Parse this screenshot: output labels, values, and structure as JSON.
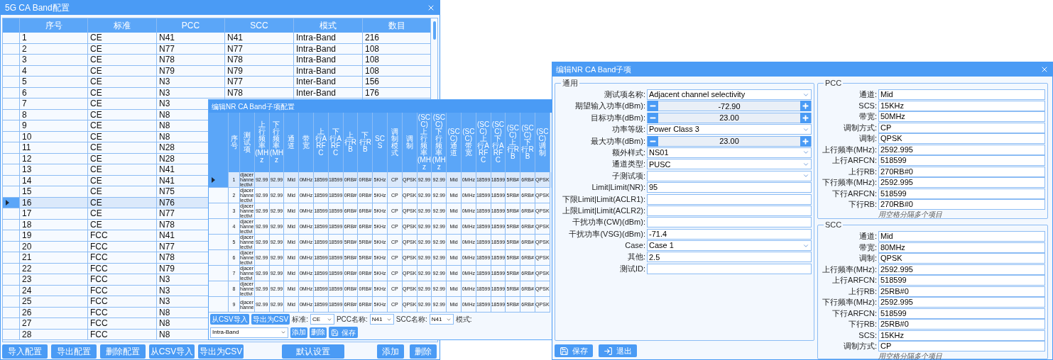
{
  "main_window": {
    "title": "5G CA Band配置",
    "table": {
      "columns": [
        "序号",
        "标准",
        "PCC",
        "SCC",
        "模式",
        "数目"
      ],
      "rows": [
        {
          "cells": [
            "1",
            "CE",
            "N41",
            "N41",
            "Intra-Band",
            "216"
          ],
          "selected": false
        },
        {
          "cells": [
            "2",
            "CE",
            "N77",
            "N77",
            "Intra-Band",
            "108"
          ],
          "selected": false
        },
        {
          "cells": [
            "3",
            "CE",
            "N78",
            "N78",
            "Intra-Band",
            "108"
          ],
          "selected": false
        },
        {
          "cells": [
            "4",
            "CE",
            "N79",
            "N79",
            "Intra-Band",
            "108"
          ],
          "selected": false
        },
        {
          "cells": [
            "5",
            "CE",
            "N3",
            "N77",
            "Inter-Band",
            "156"
          ],
          "selected": false
        },
        {
          "cells": [
            "6",
            "CE",
            "N3",
            "N78",
            "Inter-Band",
            "176"
          ],
          "selected": false
        },
        {
          "cells": [
            "7",
            "CE",
            "N3"
          ],
          "selected": false
        },
        {
          "cells": [
            "8",
            "CE",
            "N8"
          ],
          "selected": false
        },
        {
          "cells": [
            "9",
            "CE",
            "N8"
          ],
          "selected": false
        },
        {
          "cells": [
            "10",
            "CE",
            "N8"
          ],
          "selected": false
        },
        {
          "cells": [
            "11",
            "CE",
            "N28"
          ],
          "selected": false
        },
        {
          "cells": [
            "12",
            "CE",
            "N28"
          ],
          "selected": false
        },
        {
          "cells": [
            "13",
            "CE",
            "N41"
          ],
          "selected": false
        },
        {
          "cells": [
            "14",
            "CE",
            "N41"
          ],
          "selected": false
        },
        {
          "cells": [
            "15",
            "CE",
            "N75"
          ],
          "selected": false
        },
        {
          "cells": [
            "16",
            "CE",
            "N76"
          ],
          "selected": true
        },
        {
          "cells": [
            "17",
            "CE",
            "N77"
          ],
          "selected": false
        },
        {
          "cells": [
            "18",
            "CE",
            "N78"
          ],
          "selected": false
        },
        {
          "cells": [
            "19",
            "FCC",
            "N41"
          ],
          "selected": false
        },
        {
          "cells": [
            "20",
            "FCC",
            "N77"
          ],
          "selected": false
        },
        {
          "cells": [
            "21",
            "FCC",
            "N78"
          ],
          "selected": false
        },
        {
          "cells": [
            "22",
            "FCC",
            "N79"
          ],
          "selected": false
        },
        {
          "cells": [
            "23",
            "FCC",
            "N3"
          ],
          "selected": false
        },
        {
          "cells": [
            "24",
            "FCC",
            "N3"
          ],
          "selected": false
        },
        {
          "cells": [
            "25",
            "FCC",
            "N3"
          ],
          "selected": false
        },
        {
          "cells": [
            "26",
            "FCC",
            "N8"
          ],
          "selected": false
        },
        {
          "cells": [
            "27",
            "FCC",
            "N8"
          ],
          "selected": false
        },
        {
          "cells": [
            "28",
            "FCC",
            "N8"
          ],
          "selected": false
        }
      ]
    },
    "buttons": {
      "left": [
        "导入配置",
        "导出配置",
        "删除配置",
        "从CSV导入",
        "导出为CSV"
      ],
      "center": [
        "默认设置"
      ],
      "right": [
        "添加",
        "删除"
      ]
    }
  },
  "sub_config_window": {
    "title": "编辑NR CA Band子项配置",
    "table": {
      "columns": [
        "序号",
        "测试项",
        "上行频率(MHz",
        "下行频率(MHz",
        "通道",
        "带宽",
        "上行ARFC",
        "下行ARFC",
        "上行RB",
        "下行RB",
        "SCS",
        "调制模式",
        "调制",
        "(SCC)上行频率(MHz",
        "(SCC)下行频率(MHz",
        "(SCC)通道",
        "(SCC)带宽",
        "(SCC)上行ARFC",
        "(SCC)下行ARFC",
        "(SCC)上行RB",
        "(SCC)下行RB",
        "(SCC)调制"
      ],
      "rows": [
        {
          "cells": [
            "1",
            "djacer hanne lectivi",
            "92.99",
            "92.99",
            "Mid",
            "0MHz",
            "18599",
            "18599",
            "0RB#",
            "0RB#",
            "5KHz",
            "CP",
            "QPSK",
            "92.99",
            "92.99",
            "Mid",
            "0MHz",
            "18599",
            "18599",
            "5RB#",
            "6RB#",
            "QPSK"
          ],
          "selected": true
        },
        {
          "cells": [
            "2",
            "djacer hanne lectivi",
            "92.99",
            "92.99",
            "Mid",
            "0MHz",
            "18599",
            "18599",
            "0RB#",
            "0RB#",
            "5KHz",
            "CP",
            "QPSK",
            "92.99",
            "92.99",
            "Mid",
            "0MHz",
            "18599",
            "18599",
            "5RB#",
            "6RB#",
            "QPSK"
          ],
          "selected": false
        },
        {
          "cells": [
            "3",
            "djacer hanne lectivi",
            "92.99",
            "92.99",
            "Mid",
            "0MHz",
            "18599",
            "18599",
            "6RB#",
            "6RB#",
            "5KHz",
            "CP",
            "QPSK",
            "92.99",
            "92.99",
            "Mid",
            "0MHz",
            "18599",
            "18599",
            "5RB#",
            "6RB#",
            "QPSK"
          ],
          "selected": false
        },
        {
          "cells": [
            "4",
            "djacer hanne lectivi",
            "92.99",
            "92.99",
            "Mid",
            "0MHz",
            "18599",
            "18599",
            "6RB#",
            "6RB#",
            "5KHz",
            "CP",
            "QPSK",
            "92.99",
            "92.99",
            "Mid",
            "0MHz",
            "18599",
            "18599",
            "5RB#",
            "6RB#",
            "QPSK"
          ],
          "selected": false
        },
        {
          "cells": [
            "5",
            "djacer hanne lectivi",
            "92.99",
            "92.99",
            "Mid",
            "0MHz",
            "18599",
            "18599",
            "5RB#",
            "5RB#",
            "5KHz",
            "CP",
            "QPSK",
            "92.99",
            "92.99",
            "Mid",
            "0MHz",
            "18599",
            "18599",
            "5RB#",
            "6RB#",
            "QPSK"
          ],
          "selected": false
        },
        {
          "cells": [
            "6",
            "djacer hanne lectivi",
            "92.99",
            "92.99",
            "Mid",
            "0MHz",
            "18599",
            "18599",
            "5RB#",
            "5RB#",
            "5KHz",
            "CP",
            "QPSK",
            "92.99",
            "92.99",
            "Mid",
            "0MHz",
            "18599",
            "18599",
            "5RB#",
            "6RB#",
            "QPSK"
          ],
          "selected": false
        },
        {
          "cells": [
            "7",
            "djacer hanne lectivi",
            "92.99",
            "92.99",
            "Mid",
            "0MHz",
            "18599",
            "18599",
            "0RB#",
            "0RB#",
            "5KHz",
            "CP",
            "QPSK",
            "92.99",
            "92.99",
            "Mid",
            "0MHz",
            "18599",
            "18599",
            "5RB#",
            "6RB#",
            "QPSK"
          ],
          "selected": false
        },
        {
          "cells": [
            "8",
            "djacer hanne lectivi",
            "92.99",
            "92.99",
            "Mid",
            "0MHz",
            "18599",
            "18599",
            "0RB#",
            "0RB#",
            "5KHz",
            "CP",
            "QPSK",
            "92.99",
            "92.99",
            "Mid",
            "0MHz",
            "18599",
            "18599",
            "5RB#",
            "6RB#",
            "QPSK"
          ],
          "selected": false
        },
        {
          "cells": [
            "9",
            "djacer hanne",
            "92.99",
            "92.99",
            "Mid",
            "0MHz",
            "18599",
            "18599",
            "6RB#",
            "6RB#",
            "5KHz",
            "CP",
            "QPSK",
            "92.99",
            "92.99",
            "Mid",
            "0MHz",
            "18599",
            "18599",
            "5RB#",
            "6RB#",
            "QPSK"
          ],
          "selected": false
        }
      ]
    },
    "toolbar": [
      {
        "kind": "button",
        "label": "从CSV导入"
      },
      {
        "kind": "button",
        "label": "导出为CSV"
      },
      {
        "kind": "label",
        "label": "标准:"
      },
      {
        "kind": "select",
        "value": "CE"
      },
      {
        "kind": "label",
        "label": "PCC名称:"
      },
      {
        "kind": "select",
        "value": "N41"
      },
      {
        "kind": "label",
        "label": "SCC名称:"
      },
      {
        "kind": "select",
        "value": "N41"
      },
      {
        "kind": "label",
        "label": "模式:"
      },
      {
        "kind": "wide_select",
        "value": "Intra-Band"
      },
      {
        "kind": "button",
        "label": "添加"
      },
      {
        "kind": "button",
        "label": "删除"
      },
      {
        "kind": "save_button",
        "label": "保存"
      }
    ]
  },
  "edit_window": {
    "title": "编辑NR CA Band子项",
    "general": {
      "title": "通用",
      "fields": [
        {
          "label": "测试项名称:",
          "kind": "select",
          "value": "Adjacent channel selectivity"
        },
        {
          "label": "期望输入功率(dBm):",
          "kind": "spin",
          "value": "-72.90"
        },
        {
          "label": "目标功率(dBm):",
          "kind": "spin",
          "value": "23.00"
        },
        {
          "label": "功率等级:",
          "kind": "select",
          "value": "Power Class 3"
        },
        {
          "label": "最大功率(dBm):",
          "kind": "spin",
          "value": "23.00"
        },
        {
          "label": "额外样式:",
          "kind": "select",
          "value": "NS01"
        },
        {
          "label": "通道类型:",
          "kind": "select",
          "value": "PUSC"
        },
        {
          "label": "子测试项:",
          "kind": "select"
        },
        {
          "label": "Limit|Limit(NR):",
          "kind": "text",
          "value": "95"
        },
        {
          "label": "下限Limit|Limit(ACLR1):",
          "kind": "text"
        },
        {
          "label": "上限Limit|Limit(ACLR2):",
          "kind": "text"
        },
        {
          "label": "干扰功率(CW)(dBm):",
          "kind": "text"
        },
        {
          "label": "干扰功率(VSG)(dBm):",
          "kind": "text",
          "value": "-71.4"
        },
        {
          "label": "Case:",
          "kind": "select",
          "value": "Case 1"
        },
        {
          "label": "其他:",
          "kind": "text",
          "value": "2.5"
        },
        {
          "label": "测试ID:",
          "kind": "text"
        }
      ]
    },
    "pcc": {
      "title": "PCC",
      "fields": [
        {
          "label": "通道:",
          "value": "Mid"
        },
        {
          "label": "SCS:",
          "value": "15KHz"
        },
        {
          "label": "带宽:",
          "value": "50MHz"
        },
        {
          "label": "调制方式:",
          "value": "CP"
        },
        {
          "label": "调制:",
          "value": "QPSK"
        },
        {
          "label": "上行频率(MHz):",
          "value": "2592.995"
        },
        {
          "label": "上行ARFCN:",
          "value": "518599"
        },
        {
          "label": "上行RB:",
          "value": "270RB#0"
        },
        {
          "label": "下行频率(MHz):",
          "value": "2592.995"
        },
        {
          "label": "下行ARFCN:",
          "value": "518599"
        },
        {
          "label": "下行RB:",
          "value": "270RB#0"
        }
      ],
      "hint": "用空格分隔多个项目"
    },
    "scc": {
      "title": "SCC",
      "fields": [
        {
          "label": "通道:",
          "value": "Mid"
        },
        {
          "label": "带宽:",
          "value": "80MHz"
        },
        {
          "label": "调制:",
          "value": "QPSK"
        },
        {
          "label": "上行频率(MHz):",
          "value": "2592.995"
        },
        {
          "label": "上行ARFCN:",
          "value": "518599"
        },
        {
          "label": "上行RB:",
          "value": "25RB#0"
        },
        {
          "label": "下行频率(MHz):",
          "value": "2592.995"
        },
        {
          "label": "下行ARFCN:",
          "value": "518599"
        },
        {
          "label": "下行RB:",
          "value": "25RB#0"
        },
        {
          "label": "SCS:",
          "value": "15KHz"
        },
        {
          "label": "调制方式:",
          "value": "CP"
        }
      ],
      "hint": "用空格分隔多个项目"
    },
    "buttons": [
      {
        "kind": "save",
        "label": "保存"
      },
      {
        "kind": "exit",
        "label": "退出"
      }
    ]
  }
}
